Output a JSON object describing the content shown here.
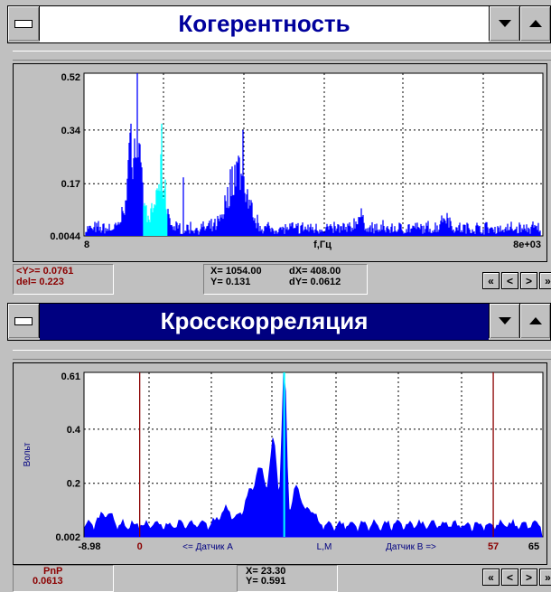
{
  "window1": {
    "title": "Когерентность",
    "status": {
      "y_mean": "<Y>= 0.0761",
      "del": "del= 0.223",
      "x": "X= 1054.00",
      "y": "Y= 0.131",
      "dx": "dX= 408.00",
      "dy": "dY= 0.0612"
    },
    "nav": [
      "«",
      "<",
      ">",
      "»"
    ]
  },
  "window2": {
    "title": "Кросскорреляция",
    "status": {
      "pnp": "PnP",
      "pnp_val": "0.0613",
      "x": "X= 23.30",
      "y": "Y= 0.591"
    },
    "nav": [
      "«",
      "<",
      ">",
      "»"
    ]
  },
  "chart_data": [
    {
      "type": "bar",
      "title": "Когерентность",
      "xlabel": "f,Гц",
      "ylabel": "",
      "x_ticks": [
        "8",
        "8e+03"
      ],
      "y_ticks": [
        "0.52",
        "0.34",
        "0.17",
        "0.0044"
      ],
      "ylim": [
        0.0044,
        0.52
      ],
      "xlim": [
        8,
        8000
      ],
      "grid": true,
      "series_colors": {
        "main": "#0000ff",
        "highlight": "#00ffff"
      },
      "peaks": [
        {
          "x": 650,
          "y": 0.52
        },
        {
          "x": 900,
          "y": 0.36
        },
        {
          "x": 1054,
          "y": 0.131
        },
        {
          "x": 2550,
          "y": 0.34
        },
        {
          "x": 4000,
          "y": 0.07
        }
      ]
    },
    {
      "type": "area",
      "title": "Кросскорреляция",
      "ylabel": "Вольт",
      "x_ticks": [
        "-8.98",
        "0",
        "57",
        "65"
      ],
      "x_annotations": [
        "<= Датчик А",
        "L,M",
        "Датчик В =>"
      ],
      "y_ticks": [
        "0.61",
        "0.4",
        "0.2",
        "0.002"
      ],
      "ylim": [
        0.002,
        0.61
      ],
      "xlim": [
        -8.98,
        65
      ],
      "grid": true,
      "markers": [
        0,
        57
      ],
      "cursor_x": 23.3,
      "series_colors": {
        "main": "#0000ff",
        "cursor": "#00ffff",
        "marker": "#8b0000"
      },
      "peaks": [
        {
          "x": 23.3,
          "y": 0.61
        },
        {
          "x": 21.5,
          "y": 0.35
        },
        {
          "x": 19,
          "y": 0.25
        },
        {
          "x": 25.5,
          "y": 0.15
        }
      ]
    }
  ]
}
